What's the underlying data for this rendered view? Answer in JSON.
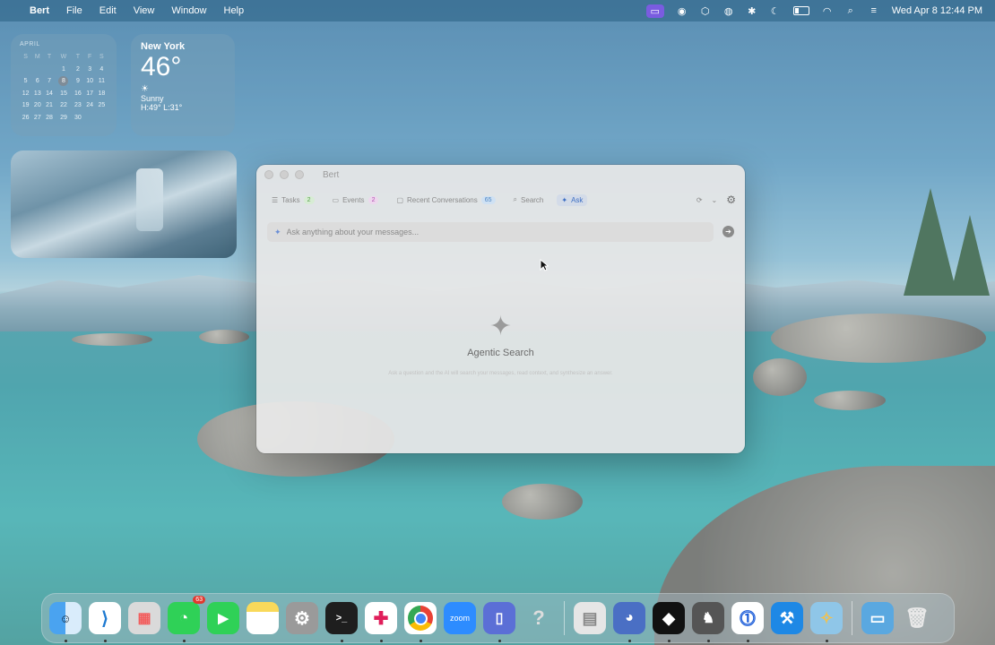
{
  "menubar": {
    "apple": "",
    "app_name": "Bert",
    "menus": [
      "File",
      "Edit",
      "View",
      "Window",
      "Help"
    ],
    "clock": "Wed Apr 8  12:44 PM"
  },
  "calendar_widget": {
    "month": "APRIL",
    "weekdays": [
      "S",
      "M",
      "T",
      "W",
      "T",
      "F",
      "S"
    ],
    "weeks": [
      [
        "",
        "",
        "",
        "1",
        "2",
        "3",
        "4"
      ],
      [
        "5",
        "6",
        "7",
        "8",
        "9",
        "10",
        "11"
      ],
      [
        "12",
        "13",
        "14",
        "15",
        "16",
        "17",
        "18"
      ],
      [
        "19",
        "20",
        "21",
        "22",
        "23",
        "24",
        "25"
      ],
      [
        "26",
        "27",
        "28",
        "29",
        "30",
        "",
        ""
      ]
    ],
    "today": "8"
  },
  "weather_widget": {
    "city": "New York",
    "temp": "46°",
    "condition_icon": "☀",
    "condition": "Sunny",
    "high_low": "H:49° L:31°"
  },
  "window": {
    "title": "Bert",
    "tabs": [
      {
        "icon": "☰",
        "label": "Tasks",
        "badge": "2"
      },
      {
        "icon": "▭",
        "label": "Events",
        "badge": "2"
      },
      {
        "icon": "▢",
        "label": "Recent Conversations",
        "badge": "65"
      },
      {
        "icon": "⌕",
        "label": "Search",
        "badge": ""
      },
      {
        "icon": "✦",
        "label": "Ask",
        "badge": ""
      }
    ],
    "ask_placeholder": "Ask anything about your messages...",
    "empty_title": "Agentic Search",
    "empty_subtitle": "Ask a question and the AI will search your messages, read context, and synthesize an answer."
  },
  "dock": {
    "messages_badge": "63",
    "zoom_label": "zoom"
  },
  "colors": {
    "accent": "#3d6fc4",
    "badge_red": "#e2382f"
  }
}
